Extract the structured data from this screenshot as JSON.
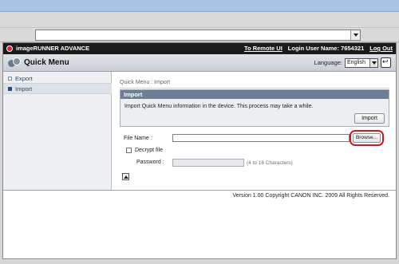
{
  "app": {
    "brand": "imageRUNNER ADVANCE",
    "links": [
      "To Remote UI",
      "Login User Name: 7654321",
      "Log Out"
    ],
    "title": "Quick Menu",
    "language_label": "Language:",
    "language_value": "English"
  },
  "sidebar": {
    "items": [
      {
        "label": "Export"
      },
      {
        "label": "Import"
      }
    ]
  },
  "main": {
    "breadcrumb": "Quick Menu : Import",
    "panel_title": "Import",
    "panel_text": "Import Quick Menu information in the device. This process may take a while.",
    "import_button": "Import",
    "file_name_label": "File Name :",
    "browse_button": "Browse...",
    "decrypt_label": "Decrypt file",
    "password_label": "Password :",
    "password_hint": "(4 to 16 Characters)"
  },
  "footer": {
    "copyright": "Version 1.00 Copyright CANON INC. 2009 All Rights Reserved."
  },
  "colors": {
    "appbar": "#1b1b1b",
    "panel_header": "#6b7f96",
    "highlight_ring": "#d0161f"
  }
}
